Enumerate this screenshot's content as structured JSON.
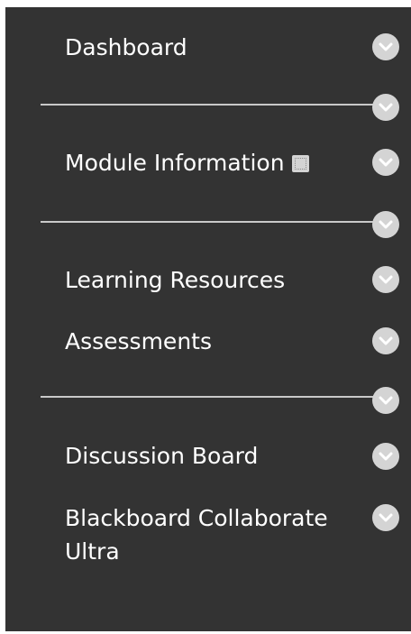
{
  "course_menu": {
    "items": [
      {
        "label": "Dashboard"
      },
      {
        "label": "Module Information"
      },
      {
        "label": "Learning Resources"
      },
      {
        "label": "Assessments"
      },
      {
        "label": "Discussion Board"
      },
      {
        "label": "Blackboard Collaborate Ultra"
      }
    ]
  },
  "icons": {
    "item_action": "chevron-down-icon",
    "content_indicator": "content-page-icon"
  },
  "colors": {
    "menu_background": "#333333",
    "text": "#ffffff",
    "divider": "#c9c9c9",
    "chevron_circle": "#d4d4d4"
  }
}
